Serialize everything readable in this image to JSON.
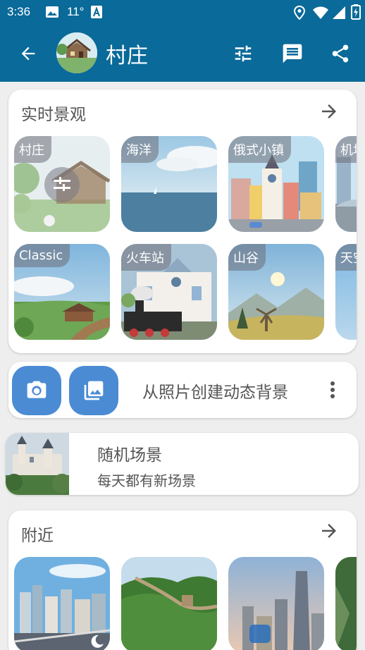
{
  "status_bar": {
    "time": "3:36",
    "temperature": "11°",
    "icons": [
      "image-icon",
      "a-icon",
      "location-icon",
      "wifi-icon",
      "battery-icon"
    ]
  },
  "app_bar": {
    "title": "村庄",
    "back_icon": "arrow-back-icon",
    "actions": [
      "tune-icon",
      "message-icon",
      "share-icon"
    ]
  },
  "live_scenes": {
    "title": "实时景观",
    "row1": [
      "村庄",
      "海洋",
      "俄式小镇",
      "机场"
    ],
    "row2": [
      "Classic",
      "火车站",
      "山谷",
      "天空"
    ]
  },
  "create_from_photo": {
    "label": "从照片创建动态背景"
  },
  "random_scene": {
    "title": "随机场景",
    "subtitle": "每天都有新场景"
  },
  "nearby": {
    "title": "附近"
  },
  "colors": {
    "primary": "#0a6a99",
    "accent": "#4a8bd4",
    "card": "#ffffff",
    "background": "#eeeeee"
  }
}
